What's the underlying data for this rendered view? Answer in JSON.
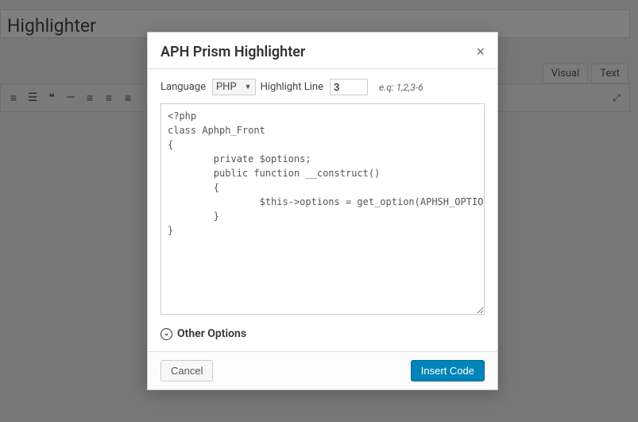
{
  "background": {
    "page_title": "Highlighter",
    "tabs": {
      "visual": "Visual",
      "text": "Text"
    },
    "toolbar_icons": [
      "list-ul",
      "list-ol",
      "quote",
      "hr",
      "align-left",
      "align-center",
      "align-right"
    ]
  },
  "modal": {
    "title": "APH Prism Highlighter",
    "close_glyph": "×",
    "language_label": "Language",
    "language_value": "PHP",
    "highlight_label": "Highlight Line",
    "highlight_value": "3",
    "highlight_hint": "e.q: 1,2,3-6",
    "code": "<?php\nclass Aphph_Front\n{\n        private $options;\n        public function __construct()\n        {\n                $this->options = get_option(APHSH_OPTION);\n        }\n}",
    "other_options_label": "Other Options",
    "cancel_label": "Cancel",
    "insert_label": "Insert Code"
  }
}
